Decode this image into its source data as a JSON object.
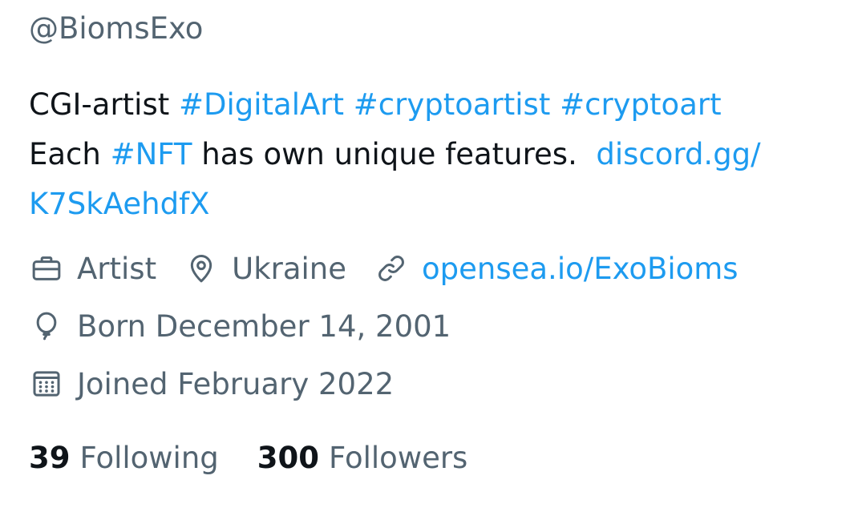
{
  "profile": {
    "handle": "@BiomsExo",
    "bio": {
      "line1": {
        "text1": "CGI-artist ",
        "tag1": "#DigitalArt",
        "sp1": " ",
        "tag2": "#cryptoartist",
        "sp2": " ",
        "tag3": "#cryptoart"
      },
      "line2": {
        "text1": "Each ",
        "tag1": "#NFT",
        "text2": " has own unique features.  ",
        "link1": "discord.gg/"
      },
      "line3": {
        "link1": "K7SkAehdfX"
      }
    },
    "meta": {
      "profession": {
        "icon": "briefcase-icon",
        "text": "Artist"
      },
      "location": {
        "icon": "location-pin-icon",
        "text": "Ukraine"
      },
      "website": {
        "icon": "link-icon",
        "text": "opensea.io/ExoBioms"
      },
      "birthday": {
        "icon": "balloon-icon",
        "text": "Born December 14, 2001"
      },
      "joined": {
        "icon": "calendar-icon",
        "text": "Joined February 2022"
      }
    },
    "stats": {
      "following": {
        "count": "39",
        "label": "Following"
      },
      "followers": {
        "count": "300",
        "label": "Followers"
      }
    }
  },
  "colors": {
    "text": "#0f1419",
    "secondary": "#536471",
    "link": "#1d9bf0",
    "background": "#ffffff"
  }
}
